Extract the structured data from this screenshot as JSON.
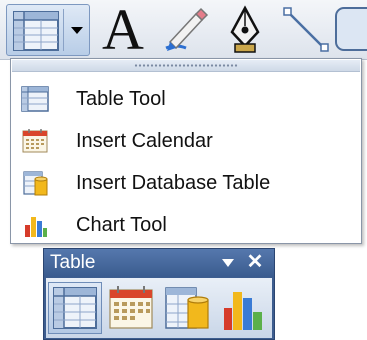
{
  "toolbar": {
    "text_tool_glyph": "A",
    "icons": [
      "table-icon",
      "chevron-down-icon",
      "text-icon",
      "pencil-icon",
      "pen-nib-icon",
      "line-icon",
      "rounded-rectangle-icon"
    ]
  },
  "menu": {
    "items": [
      {
        "label": "Table Tool",
        "icon": "table-icon"
      },
      {
        "label": "Insert Calendar",
        "icon": "calendar-icon"
      },
      {
        "label": "Insert Database Table",
        "icon": "database-table-icon"
      },
      {
        "label": "Chart Tool",
        "icon": "bar-chart-icon"
      }
    ]
  },
  "floating_toolbar": {
    "title": "Table",
    "close_glyph": "✕",
    "icons": [
      "table-icon",
      "calendar-icon",
      "database-table-icon",
      "bar-chart-icon"
    ]
  },
  "colors": {
    "title_bar": "#3d5d8f",
    "accent_blue": "#5578ad",
    "calendar_red": "#d9462b",
    "chart_red": "#d63b2a",
    "chart_yellow": "#f2b81c",
    "chart_blue": "#3a7bd5",
    "chart_green": "#5bb04a"
  }
}
